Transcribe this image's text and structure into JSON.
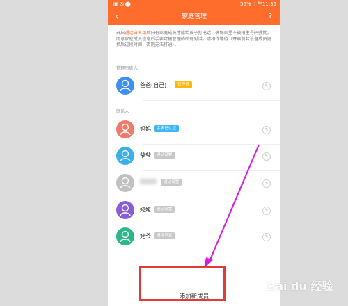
{
  "statusbar": {
    "right_text": "56% 上午11:35"
  },
  "navbar": {
    "back_icon": "chevron-left-icon",
    "title": "家庭管理",
    "help": "?"
  },
  "notice": {
    "prefix": "开启",
    "highlight": "通话白名单",
    "body": "后只有家庭成员才能给孩子打电话，确保家里不被陌生号码骚扰，同意家庭成员信息后手表可被管理的所有对讲，请相作等待（开启前若设备成员更换后过段时间，否则无法打通）。"
  },
  "sections": {
    "admin_label": "管理员家人",
    "members_label": "联系人"
  },
  "admin": {
    "name": "爸爸(自己)",
    "tag": "管理员",
    "tag_color": "#ffb800",
    "avatar_color": "#3d8ff0"
  },
  "members": [
    {
      "name": "妈妈",
      "tag": "手表已认证",
      "tag_color": "#3fb6f5",
      "avatar_color": "#f07a6a",
      "blur": false
    },
    {
      "name": "爷爷",
      "tag": "通话设置",
      "tag_color": "#c8c8c8",
      "avatar_color": "#3ab0e8",
      "blur": false
    },
    {
      "name": "",
      "tag": "通话设置",
      "tag_color": "#c8c8c8",
      "avatar_color": "#c0c0c0",
      "blur": true
    },
    {
      "name": "姥姥",
      "tag": "通话设置",
      "tag_color": "#c8c8c8",
      "avatar_color": "#8a5dd8",
      "blur": false
    },
    {
      "name": "姥爷",
      "tag": "通话设置",
      "tag_color": "#c8c8c8",
      "avatar_color": "#2ab88a",
      "blur": true
    }
  ],
  "add_member": "添加新成员",
  "watermark": "Bai du 经验",
  "colors": {
    "accent": "#ff6d2c",
    "annotation": "#e03a3a",
    "arrow": "#d020e0"
  }
}
